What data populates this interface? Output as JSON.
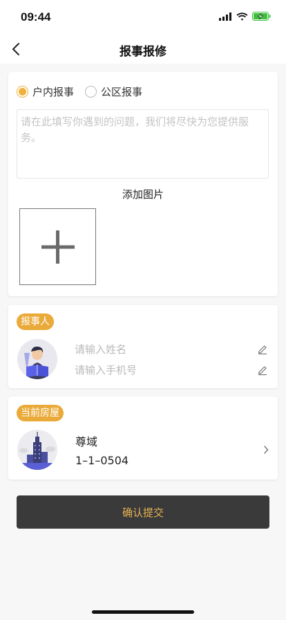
{
  "status_bar": {
    "time": "09:44",
    "icons": [
      "signal-icon",
      "wifi-icon",
      "battery-charging-icon"
    ],
    "battery_color": "#3dc13c"
  },
  "nav": {
    "title": "报事报修",
    "back_icon": "chevron-left-icon"
  },
  "report": {
    "types": [
      {
        "label": "户内报事",
        "checked": true
      },
      {
        "label": "公区报事",
        "checked": false
      }
    ],
    "textarea_placeholder": "请在此填写你遇到的问题，我们将尽快为您提供服务。",
    "add_photo_label": "添加图片",
    "add_photo_icon": "plus-icon"
  },
  "reporter": {
    "tag": "报事人",
    "name_placeholder": "请输入姓名",
    "phone_placeholder": "请输入手机号",
    "edit_icon": "pencil-icon"
  },
  "house": {
    "tag": "当前房屋",
    "name": "尊域",
    "unit": "1–1–0504",
    "chevron_icon": "chevron-right-icon"
  },
  "submit": {
    "label": "确认提交"
  },
  "colors": {
    "accent": "#eaaa3a",
    "button_bg": "#3a3a3a",
    "button_text": "#e8b356",
    "page_bg": "#f7f7f7"
  }
}
